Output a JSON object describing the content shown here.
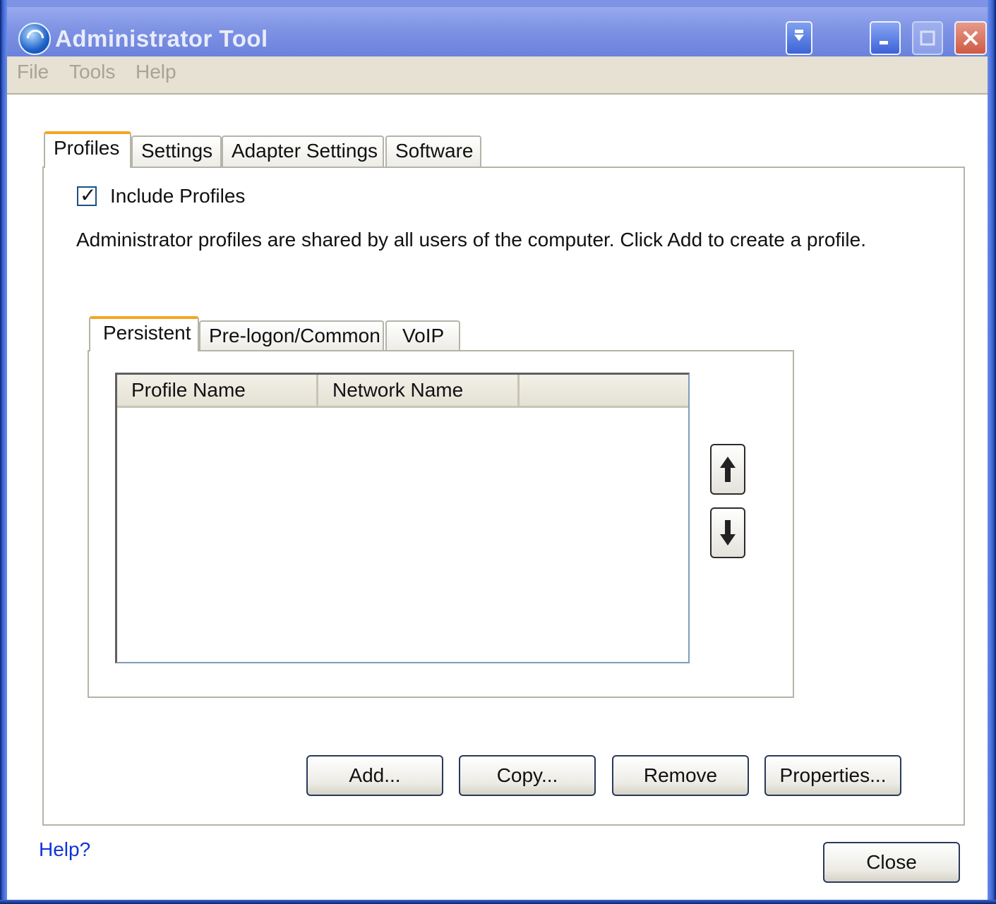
{
  "window": {
    "title": "Administrator Tool",
    "app_icon": "wireless-signal-icon",
    "controls": {
      "extra": "pin-icon",
      "minimize": "minimize-icon",
      "maximize": "maximize-icon",
      "close": "close-icon"
    }
  },
  "menu": {
    "items": [
      "File",
      "Tools",
      "Help"
    ]
  },
  "tabs": {
    "items": [
      "Profiles",
      "Settings",
      "Adapter Settings",
      "Software"
    ],
    "active": "Profiles"
  },
  "profiles": {
    "include_label": "Include Profiles",
    "include_checked": true,
    "description": "Administrator profiles are shared by all users of the computer. Click Add to create a profile."
  },
  "subtabs": {
    "items": [
      "Persistent",
      "Pre-logon/Common",
      "VoIP"
    ],
    "active": "Persistent"
  },
  "list": {
    "columns": [
      "Profile Name",
      "Network Name"
    ],
    "rows": []
  },
  "buttons": {
    "move_up": "arrow-up-icon",
    "move_down": "arrow-down-icon",
    "add": "Add...",
    "copy": "Copy...",
    "remove": "Remove",
    "properties": "Properties...",
    "close": "Close"
  },
  "footer": {
    "help": "Help?"
  },
  "colors": {
    "title_bar": "#7f93e4",
    "frame": "#3c64d6",
    "tab_highlight": "#f5a623",
    "link": "#1034d8"
  }
}
